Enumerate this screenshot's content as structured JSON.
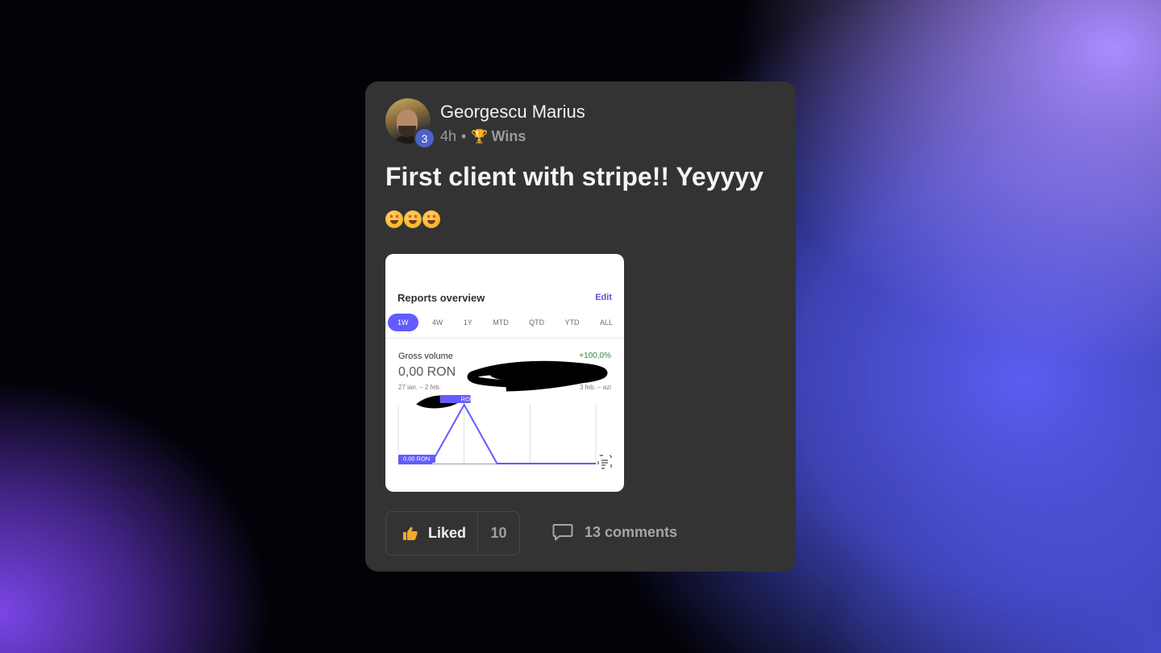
{
  "post": {
    "author": "Georgescu Marius",
    "level": "3",
    "time": "4h",
    "separator": "•",
    "category_icon": "trophy-icon",
    "category": "Wins",
    "title": "First client with stripe!! Yeyyyy",
    "emoji": [
      "star-struck-emoji",
      "star-struck-emoji",
      "star-struck-emoji"
    ]
  },
  "attachment": {
    "title": "Reports overview",
    "edit_label": "Edit",
    "tabs": [
      "1W",
      "4W",
      "1Y",
      "MTD",
      "QTD",
      "YTD",
      "ALL"
    ],
    "active_tab": "1W",
    "metric_label": "Gross volume",
    "change": "+100,0%",
    "value": "0,00 RON",
    "range_left": "27 ian. – 2 feb.",
    "range_right": "3 feb. – azi",
    "baseline_label": "0,00 RON",
    "peak_label": "RON",
    "colors": {
      "accent": "#635bff",
      "positive": "#2e8a3a"
    },
    "chart_data": {
      "type": "line",
      "series": [
        {
          "values": [
            0,
            0,
            1,
            0,
            0,
            0,
            0
          ]
        }
      ]
    }
  },
  "actions": {
    "like_label": "Liked",
    "like_count": "10",
    "like_icon": "thumbs-up-icon",
    "comments_icon": "comment-icon",
    "comments_label": "13 comments"
  },
  "colors": {
    "card_bg": "#333333",
    "level_badge": "#4e62c7"
  }
}
